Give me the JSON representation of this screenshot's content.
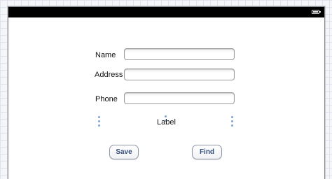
{
  "form": {
    "name_label": "Name",
    "address_label": "Address",
    "phone_label": "Phone",
    "name_value": "",
    "address_value": "",
    "phone_value": "",
    "center_label": "Label"
  },
  "buttons": {
    "save": "Save",
    "find": "Find"
  },
  "status_bar": {
    "battery_icon": "battery-icon"
  }
}
